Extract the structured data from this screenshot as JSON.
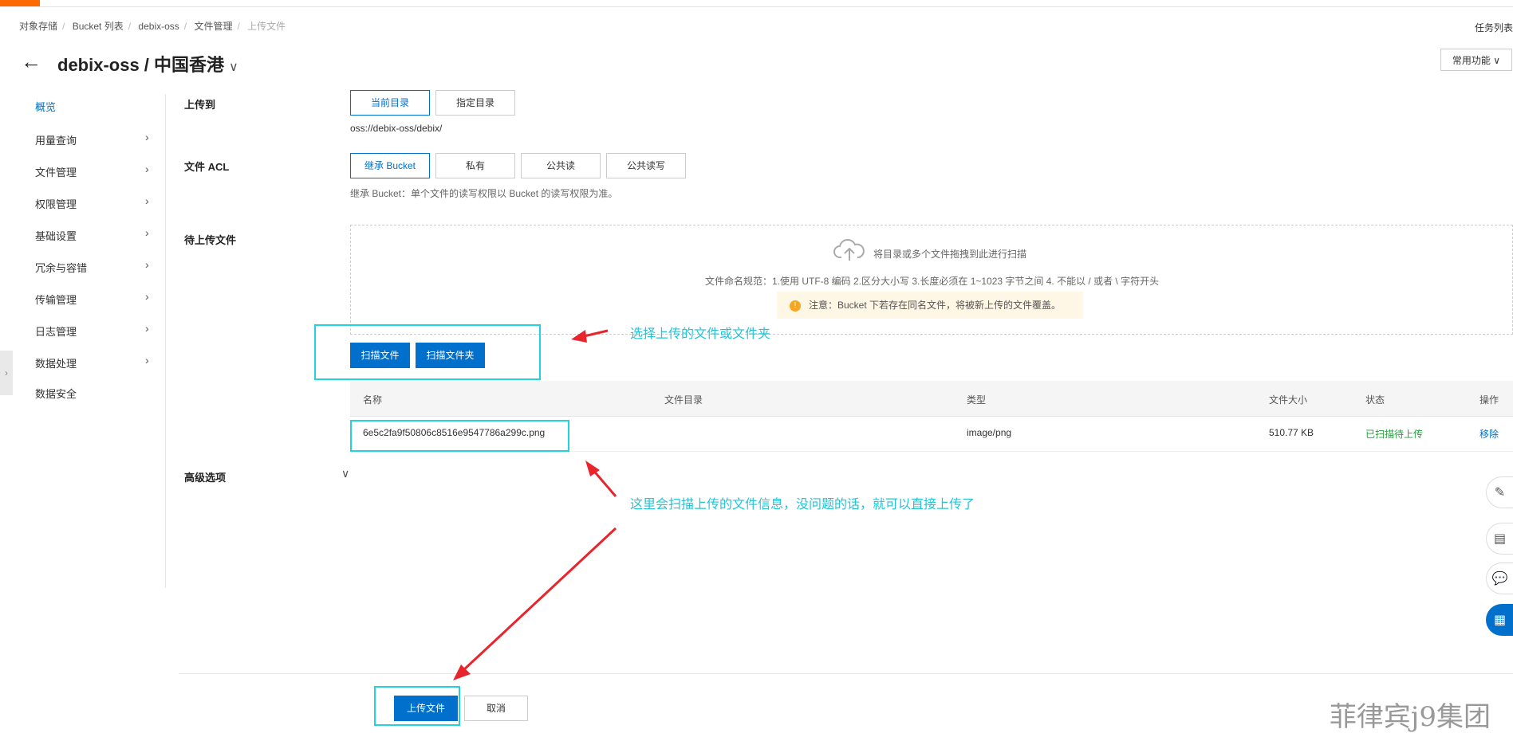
{
  "breadcrumb": [
    "对象存储",
    "Bucket 列表",
    "debix-oss",
    "文件管理",
    "上传文件"
  ],
  "task_list": "任务列表",
  "page_title": "debix-oss / 中国香港",
  "common_functions": "常用功能",
  "sidebar": {
    "items": [
      {
        "label": "概览"
      },
      {
        "label": "用量查询"
      },
      {
        "label": "文件管理"
      },
      {
        "label": "权限管理"
      },
      {
        "label": "基础设置"
      },
      {
        "label": "冗余与容错"
      },
      {
        "label": "传输管理"
      },
      {
        "label": "日志管理"
      },
      {
        "label": "数据处理"
      },
      {
        "label": "数据安全"
      }
    ]
  },
  "upload_to": {
    "label": "上传到",
    "options": [
      "当前目录",
      "指定目录"
    ],
    "path": "oss://debix-oss/debix/"
  },
  "file_acl": {
    "label": "文件 ACL",
    "options": [
      "继承 Bucket",
      "私有",
      "公共读",
      "公共读写"
    ],
    "hint": "继承 Bucket：单个文件的读写权限以 Bucket 的读写权限为准。"
  },
  "pending": {
    "label": "待上传文件",
    "drop_text": "将目录或多个文件拖拽到此进行扫描",
    "naming_rule": "文件命名规范：1.使用 UTF-8 编码 2.区分大小写 3.长度必须在 1~1023 字节之间 4. 不能以 / 或者 \\ 字符开头",
    "warning": "注意：Bucket 下若存在同名文件，将被新上传的文件覆盖。",
    "scan_file": "扫描文件",
    "scan_folder": "扫描文件夹"
  },
  "table": {
    "headers": [
      "名称",
      "文件目录",
      "类型",
      "文件大小",
      "状态",
      "操作"
    ],
    "rows": [
      {
        "name": "6e5c2fa9f50806c8516e9547786a299c.png",
        "dir": "",
        "type": "image/png",
        "size": "510.77 KB",
        "status": "已扫描待上传",
        "action": "移除"
      }
    ]
  },
  "advanced": "高级选项",
  "footer": {
    "upload": "上传文件",
    "cancel": "取消"
  },
  "annotations": {
    "a1": "选择上传的文件或文件夹",
    "a2": "这里会扫描上传的文件信息，没问题的话，就可以直接上传了"
  },
  "watermark": "菲律宾j9集团",
  "colors": {
    "primary": "#0070cc",
    "status_ok": "#22a03a",
    "annotation": "#22c5d8",
    "arrow": "#e8242c"
  }
}
